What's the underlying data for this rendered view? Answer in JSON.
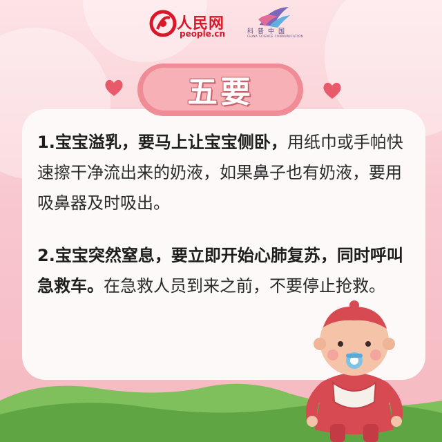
{
  "header": {
    "people_daily_name": "人民网",
    "people_daily_url": "people.cn",
    "kepu_name": "科普中国",
    "kepu_sub": "CHINA SCIENCE COMMUNICATION"
  },
  "title": "五要",
  "items": [
    {
      "bold": "1.宝宝溢乳，要马上让宝宝侧卧，",
      "normal": "用纸巾或手帕快速擦干净流出来的奶液，如果鼻子也有奶液，要用吸鼻器及时吸出。"
    },
    {
      "bold": "2.宝宝突然窒息，要立即开始心肺复苏，同时呼叫急救车。",
      "normal": "在急救人员到来之前，不要停止抢救。"
    }
  ],
  "colors": {
    "brand_red": "#d8172a",
    "title_pill": "#ef8c95",
    "card": "#fdf9f8",
    "grass": "#6fb24f"
  },
  "icons": [
    "heart-icon",
    "people-daily-emblem-icon",
    "kepu-logo-icon",
    "baby-illustration"
  ]
}
